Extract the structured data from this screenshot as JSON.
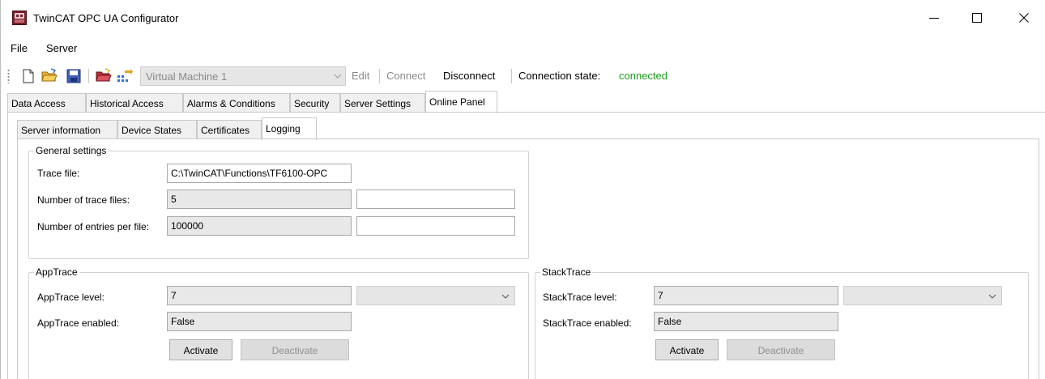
{
  "window": {
    "title": "TwinCAT OPC UA Configurator"
  },
  "menu": {
    "items": [
      "File",
      "Server"
    ]
  },
  "toolbar": {
    "target_value": "Virtual Machine 1",
    "edit_label": "Edit",
    "connect_label": "Connect",
    "disconnect_label": "Disconnect",
    "connection_state_label": "Connection state:",
    "connection_state_value": "connected",
    "connection_state_color": "#1b9e1b"
  },
  "tabs": {
    "items": [
      "Data Access",
      "Historical Access",
      "Alarms & Conditions",
      "Security",
      "Server Settings",
      "Online Panel"
    ],
    "active": "Online Panel"
  },
  "subtabs": {
    "items": [
      "Server information",
      "Device States",
      "Certificates",
      "Logging"
    ],
    "active": "Logging"
  },
  "general": {
    "title": "General settings",
    "trace_file_label": "Trace file:",
    "trace_file_value": "C:\\TwinCAT\\Functions\\TF6100-OPC",
    "num_trace_files_label": "Number of trace files:",
    "num_trace_files_value": "5",
    "num_trace_files_new": "",
    "entries_label": "Number of entries per file:",
    "entries_value": "100000",
    "entries_new": ""
  },
  "apptrace": {
    "title": "AppTrace",
    "level_label": "AppTrace level:",
    "level_value": "7",
    "enabled_label": "AppTrace enabled:",
    "enabled_value": "False",
    "activate_label": "Activate",
    "deactivate_label": "Deactivate"
  },
  "stacktrace": {
    "title": "StackTrace",
    "level_label": "StackTrace level:",
    "level_value": "7",
    "enabled_label": "StackTrace enabled:",
    "enabled_value": "False",
    "activate_label": "Activate",
    "deactivate_label": "Deactivate"
  }
}
